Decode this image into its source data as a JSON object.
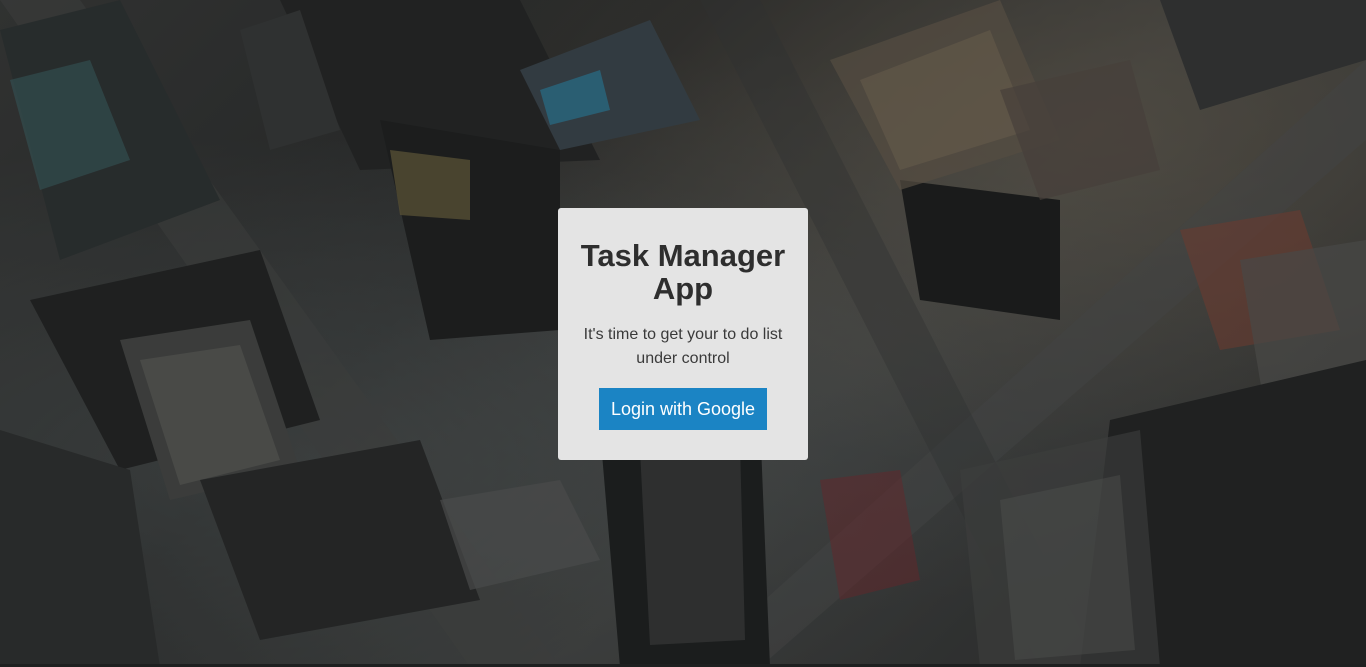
{
  "login_card": {
    "title": "Task Manager App",
    "subtitle": "It's time to get your to do list under control",
    "login_button_label": "Login with Google"
  },
  "colors": {
    "card_background": "#e4e4e4",
    "button_background": "#1b84c4",
    "button_text": "#ffffff",
    "title_text": "#2e2e2e"
  }
}
